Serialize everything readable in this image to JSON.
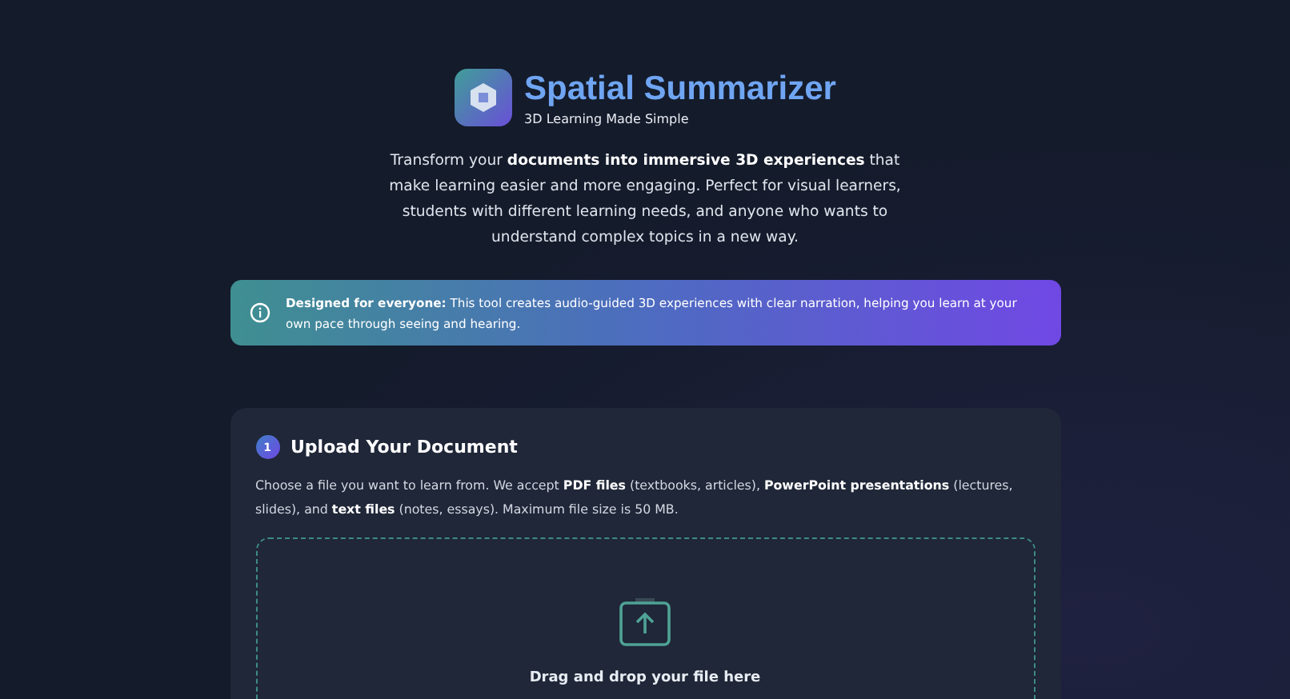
{
  "header": {
    "title": "Spatial Summarizer",
    "subtitle": "3D Learning Made Simple"
  },
  "intro": "Transform your **documents into immersive 3D experiences** that make learning easier and more engaging. Perfect for visual learners, students with different learning needs, and anyone who wants to understand complex topics in a new way.",
  "notice": "**Designed for everyone:** This tool creates audio-guided 3D experiences with clear narration, helping you learn at your own pace through seeing and hearing.",
  "upload": {
    "step": "1",
    "title": "Upload Your Document",
    "description": "Choose a file you want to learn from. We accept **PDF files** (textbooks, articles), **PowerPoint presentations** (lectures, slides), and **text files** (notes, essays). Maximum file size is 50 MB.",
    "dropzone_text": "Drag and drop your file here"
  }
}
